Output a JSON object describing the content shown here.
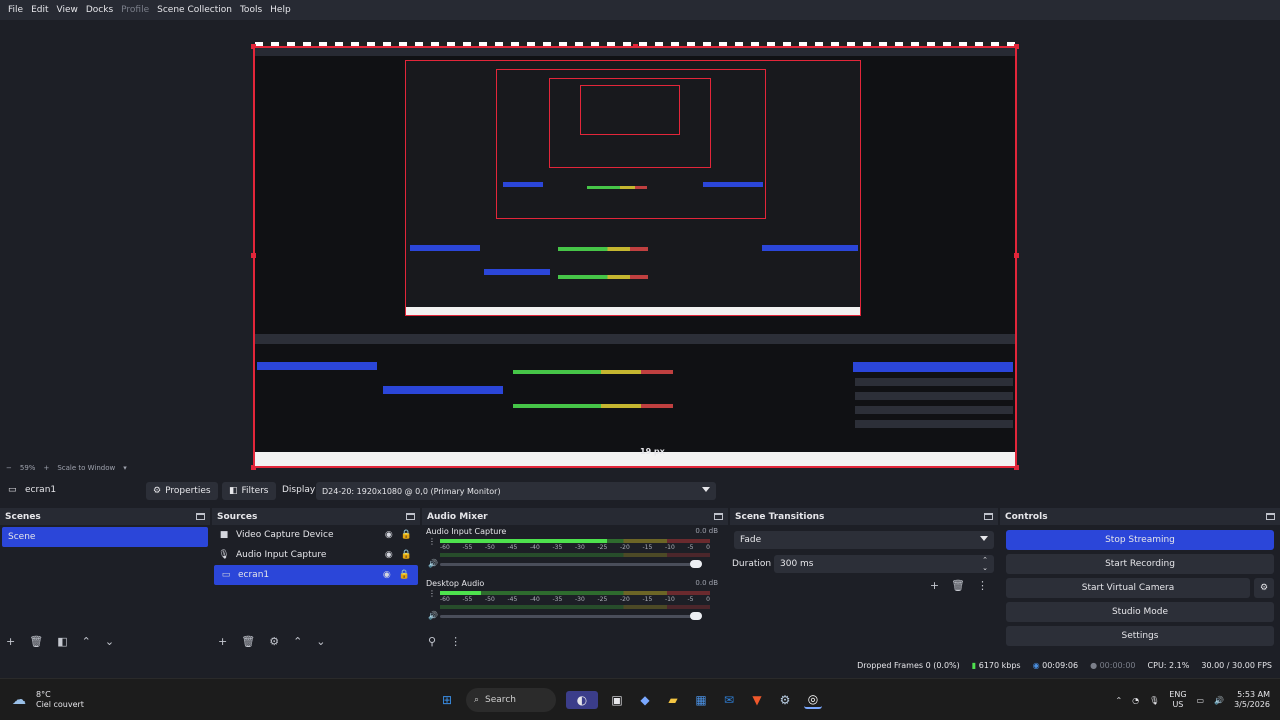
{
  "menu": [
    "File",
    "Edit",
    "View",
    "Docks",
    "Profile",
    "Scene Collection",
    "Tools",
    "Help"
  ],
  "preview": {
    "px_label": "19 px",
    "zoom": "59%",
    "scale_mode": "Scale to Window"
  },
  "source_toolbar": {
    "source_name": "ecran1",
    "properties": "Properties",
    "filters": "Filters",
    "display_label": "Display",
    "display_value": "D24-20: 1920x1080 @ 0,0 (Primary Monitor)"
  },
  "scenes": {
    "title": "Scenes",
    "items": [
      {
        "label": "Scene",
        "selected": true
      }
    ]
  },
  "sources": {
    "title": "Sources",
    "items": [
      {
        "label": "Video Capture Device",
        "icon": "camera-icon",
        "selected": false
      },
      {
        "label": "Audio Input Capture",
        "icon": "microphone-icon",
        "selected": false
      },
      {
        "label": "ecran1",
        "icon": "monitor-icon",
        "selected": true
      }
    ]
  },
  "mixer": {
    "title": "Audio Mixer",
    "ticks": [
      "-60",
      "-55",
      "-50",
      "-45",
      "-40",
      "-35",
      "-30",
      "-25",
      "-20",
      "-15",
      "-10",
      "-5",
      "0"
    ],
    "channels": [
      {
        "name": "Audio Input Capture",
        "db": "0.0 dB",
        "level": 0.62,
        "volume": 1.0
      },
      {
        "name": "Desktop Audio",
        "db": "0.0 dB",
        "level": 0.15,
        "volume": 1.0
      }
    ]
  },
  "transitions": {
    "title": "Scene Transitions",
    "selected": "Fade",
    "duration_label": "Duration",
    "duration_value": "300 ms"
  },
  "controls": {
    "title": "Controls",
    "stop_streaming": "Stop Streaming",
    "start_recording": "Start Recording",
    "start_virtual_camera": "Start Virtual Camera",
    "studio_mode": "Studio Mode",
    "settings": "Settings"
  },
  "status": {
    "dropped_frames": "Dropped Frames 0 (0.0%)",
    "bitrate": "6170 kbps",
    "stream_time": "00:09:06",
    "record_time": "00:00:00",
    "cpu": "CPU: 2.1%",
    "fps": "30.00 / 30.00 FPS"
  },
  "taskbar": {
    "weather_temp": "8°C",
    "weather_desc": "Ciel couvert",
    "search": "Search",
    "lang": "ENG",
    "region": "US",
    "time": "5:53 AM",
    "date": "3/5/2026"
  },
  "colors": {
    "accent": "#2b46d9",
    "selection_border": "#e2263a",
    "meter_green": "#4ee24e"
  }
}
